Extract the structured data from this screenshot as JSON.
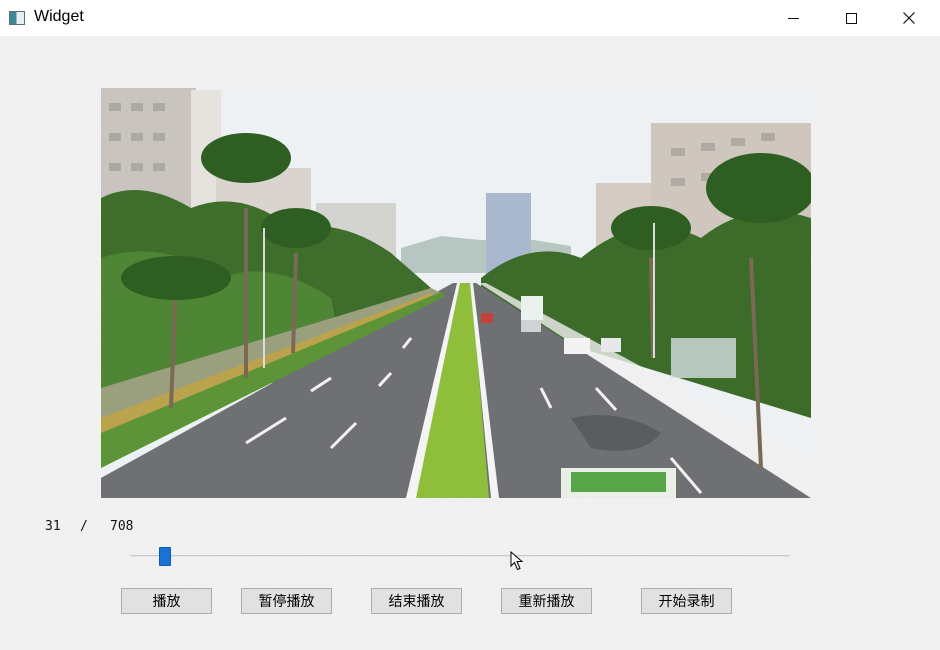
{
  "window": {
    "title": "Widget",
    "minimize_icon": "minimize-icon",
    "maximize_icon": "maximize-icon",
    "close_icon": "close-icon"
  },
  "video": {
    "description_icon": "video-frame"
  },
  "playback": {
    "current_frame": "31",
    "separator": "/",
    "total_frames": "708",
    "progress_fraction": 0.044
  },
  "buttons": {
    "play": "播放",
    "pause": "暂停播放",
    "stop": "结束播放",
    "replay": "重新播放",
    "record": "开始录制"
  },
  "colors": {
    "slider_handle": "#1a72d4",
    "window_bg": "#f0f0f0"
  }
}
